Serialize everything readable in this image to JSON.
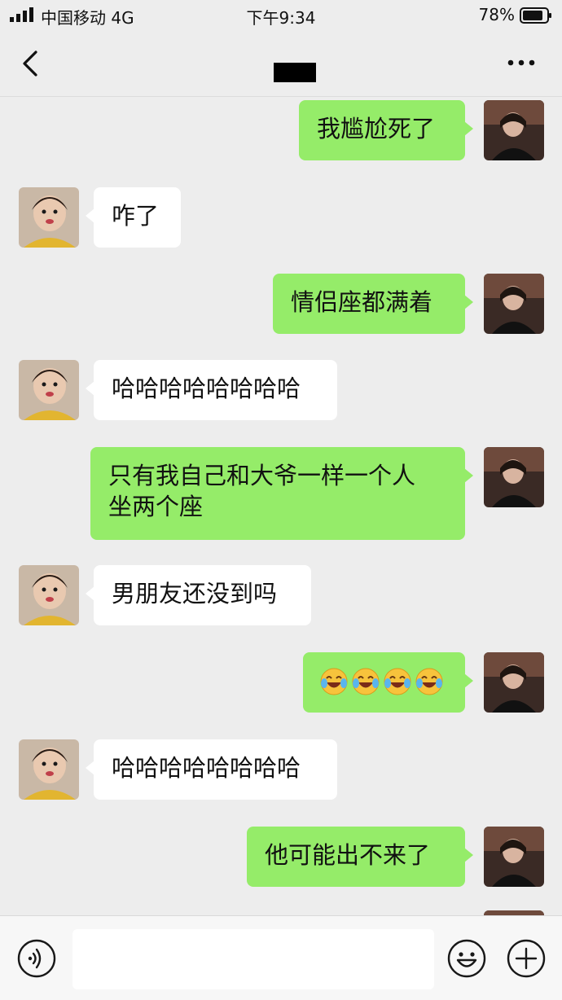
{
  "status_bar": {
    "carrier": "中国移动 4G",
    "time": "下午9:34",
    "battery": "78%"
  },
  "nav": {
    "title": ""
  },
  "messages": [
    {
      "from": "me",
      "text": "我尴尬死了"
    },
    {
      "from": "friend",
      "text": "咋了"
    },
    {
      "from": "me",
      "text": "情侣座都满着"
    },
    {
      "from": "friend",
      "text": "哈哈哈哈哈哈哈哈"
    },
    {
      "from": "me",
      "text_line1": "只有我自己和大爷一样一个人",
      "text_line2": "坐两个座"
    },
    {
      "from": "friend",
      "text": "男朋友还没到吗"
    },
    {
      "from": "me",
      "emojis": [
        "laughing-crying",
        "laughing-crying",
        "laughing-crying",
        "laughing-crying"
      ]
    },
    {
      "from": "friend",
      "text": "哈哈哈哈哈哈哈哈"
    },
    {
      "from": "me",
      "text": "他可能出不来了"
    }
  ],
  "input": {
    "placeholder": ""
  },
  "colors": {
    "sent_bubble": "#95ec69",
    "received_bubble": "#ffffff",
    "background": "#ededed"
  },
  "icons": [
    "signal-icon",
    "battery-icon",
    "back-icon",
    "more-icon",
    "voice-icon",
    "emoji-icon",
    "plus-icon"
  ]
}
